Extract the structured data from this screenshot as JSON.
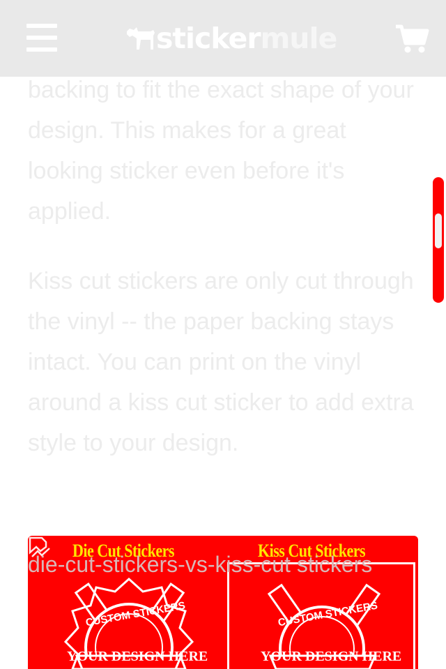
{
  "header": {
    "menu_icon": "hamburger-menu-icon",
    "logo_part1": "sticker",
    "logo_part2": "mule",
    "logo_icon": "mule-icon",
    "cart_icon": "shopping-cart-icon",
    "background": "#e9e9e9"
  },
  "article": {
    "paragraph1": "backing to fit the exact shape of your design. This makes for a great looking sticker even before it's applied.",
    "paragraph2": "Kiss cut stickers are only cut through the vinyl -- the paper backing stays intact. You can print on the vinyl around a kiss cut sticker to add extra style to your design.",
    "text_color": "#ececec"
  },
  "image": {
    "alt_text": "die-cut-stickers-vs-kiss-cut stickers",
    "left_title": "Die Cut Stickers",
    "right_title": "Kiss Cut Stickers",
    "sticker_top_text": "CUSTOM STICKERS",
    "sticker_banner_text": "YOUR DESIGN HERE",
    "broken_image_icon": "broken-image-icon",
    "background": "#ff0000",
    "accent": "#ffe600"
  },
  "scrollbar": {
    "color": "#ff0000",
    "thumb_color": "#f2f2f2"
  }
}
